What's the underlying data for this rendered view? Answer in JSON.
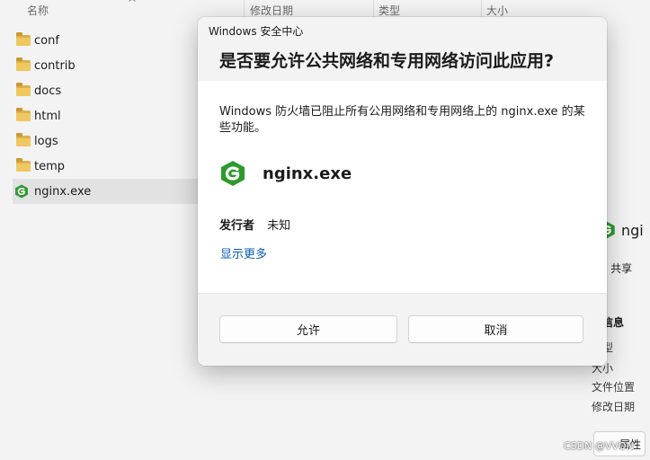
{
  "explorer": {
    "columns": {
      "name": "名称",
      "modified": "修改日期",
      "type": "类型",
      "size": "大小"
    },
    "files": [
      {
        "name": "conf",
        "icon": "folder-icon"
      },
      {
        "name": "contrib",
        "icon": "folder-icon"
      },
      {
        "name": "docs",
        "icon": "folder-icon"
      },
      {
        "name": "html",
        "icon": "folder-icon"
      },
      {
        "name": "logs",
        "icon": "folder-icon"
      },
      {
        "name": "temp",
        "icon": "folder-icon"
      },
      {
        "name": "nginx.exe",
        "icon": "nginx-icon",
        "selected": true
      }
    ],
    "details": {
      "name_partial": "ngi",
      "share_label": "共享",
      "section_title": "细信息",
      "type_label": "型",
      "size_label": "大小",
      "location_label": "文件位置",
      "modified_label": "修改日期",
      "properties_label": "属性"
    }
  },
  "dialog": {
    "app_title": "Windows 安全中心",
    "title": "是否要允许公共网络和专用网络访问此应用?",
    "message": "Windows 防火墙已阻止所有公用网络和专用网络上的 nginx.exe 的某些功能。",
    "app_name": "nginx.exe",
    "publisher_label": "发行者",
    "publisher_value": "未知",
    "more_link": "显示更多",
    "allow_button": "允许",
    "cancel_button": "取消"
  },
  "watermark": "CSDN @ᐯᐯON",
  "colors": {
    "accent_link": "#0a5bb5",
    "nginx_green": "#2e9a2e",
    "folder_yellow": "#f0c862"
  }
}
